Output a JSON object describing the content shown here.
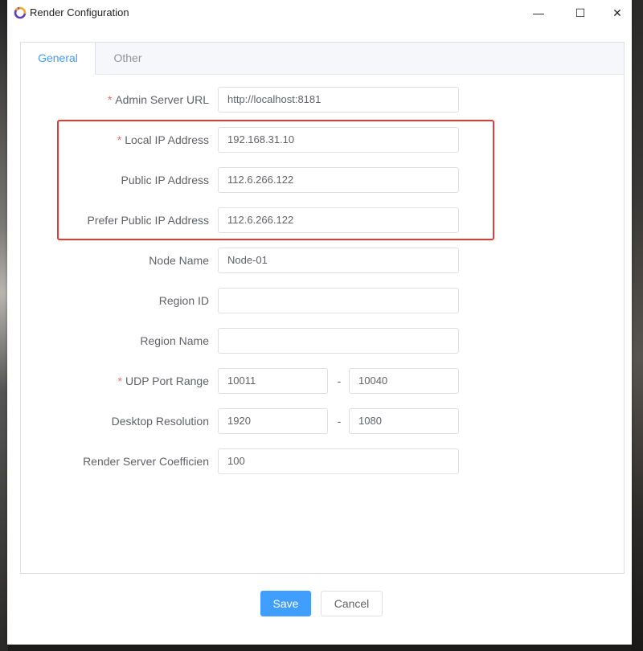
{
  "window": {
    "title": "Render Configuration",
    "min_symbol": "—",
    "max_symbol": "☐",
    "close_symbol": "✕"
  },
  "tabs": [
    {
      "label": "General",
      "active": true
    },
    {
      "label": "Other",
      "active": false
    }
  ],
  "required_marker": "*",
  "form": {
    "admin_server_url": {
      "label": "Admin Server URL",
      "value": "http://localhost:8181",
      "required": true
    },
    "local_ip": {
      "label": "Local IP Address",
      "value": "192.168.31.10",
      "required": true
    },
    "public_ip": {
      "label": "Public IP Address",
      "value": "112.6.266.122"
    },
    "prefer_public_ip": {
      "label": "Prefer Public IP Address",
      "value": "112.6.266.122"
    },
    "node_name": {
      "label": "Node Name",
      "value": "Node-01"
    },
    "region_id": {
      "label": "Region ID",
      "value": ""
    },
    "region_name": {
      "label": "Region Name",
      "value": ""
    },
    "udp_port_range": {
      "label": "UDP Port Range",
      "from": "10011",
      "to": "10040",
      "separator": "-",
      "required": true
    },
    "desktop_resolution": {
      "label": "Desktop Resolution",
      "width": "1920",
      "height": "1080",
      "separator": "-"
    },
    "render_server_coefficient": {
      "label": "Render Server Coefficien",
      "value": "100"
    }
  },
  "buttons": {
    "save": "Save",
    "cancel": "Cancel"
  },
  "colors": {
    "accent": "#409eff",
    "required": "#f56c6c",
    "highlight_border": "#e53935"
  },
  "icons": {
    "app": "render-app-logo-icon"
  }
}
